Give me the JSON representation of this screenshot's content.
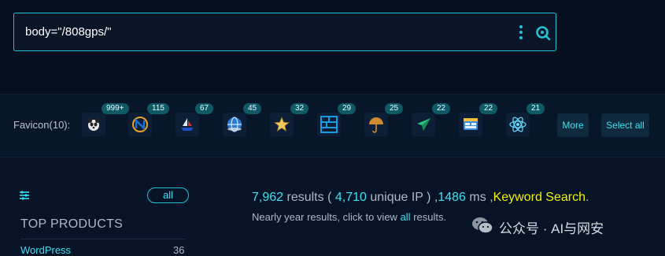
{
  "search": {
    "query": "body=\"/808gps/\""
  },
  "favicons": {
    "label": "Favicon(10):",
    "items": [
      {
        "icon": "panda-icon",
        "count": "999+"
      },
      {
        "icon": "n-logo-icon",
        "count": "115"
      },
      {
        "icon": "ship-icon",
        "count": "67"
      },
      {
        "icon": "globe-icon",
        "count": "45"
      },
      {
        "icon": "star-icon",
        "count": "32"
      },
      {
        "icon": "grid-icon",
        "count": "29"
      },
      {
        "icon": "umbrella-icon",
        "count": "25"
      },
      {
        "icon": "paper-plane-icon",
        "count": "22"
      },
      {
        "icon": "window-icon",
        "count": "22"
      },
      {
        "icon": "react-icon",
        "count": "21"
      }
    ],
    "more_label": "More",
    "select_all_label": "Select all"
  },
  "sidebar": {
    "all_label": "all",
    "top_products_title": "TOP PRODUCTS",
    "products": [
      {
        "name": "WordPress",
        "count": "36"
      }
    ]
  },
  "results": {
    "total": "7,962",
    "results_word": " results ( ",
    "unique": "4,710",
    "unique_word": " unique IP ) ,",
    "ms": "1486",
    "ms_word": " ms ,",
    "mode": "Keyword Search",
    "end": ".",
    "sub_prefix": "Nearly year results, click to view ",
    "sub_link": "all",
    "sub_suffix": " results."
  },
  "watermark": {
    "text": "公众号 · AI与网安"
  },
  "colors": {
    "accent": "#22c3d6",
    "highlight": "#f2f200",
    "background": "#071327"
  }
}
